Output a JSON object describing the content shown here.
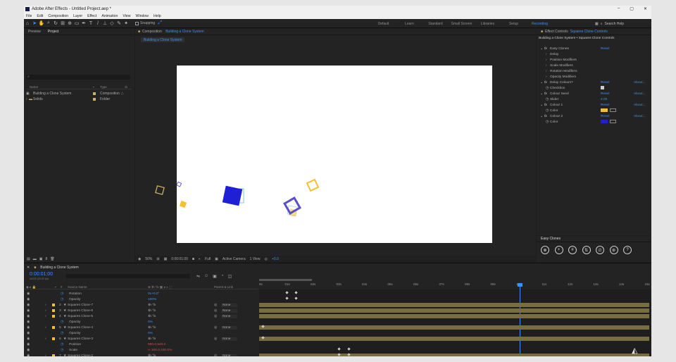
{
  "window": {
    "title": "Adobe After Effects - Untitled Project.aep *",
    "controls": [
      "–",
      "▢",
      "✕"
    ]
  },
  "menu": [
    "File",
    "Edit",
    "Composition",
    "Layer",
    "Effect",
    "Animation",
    "View",
    "Window",
    "Help"
  ],
  "toolbar": {
    "snapping": "Snapping"
  },
  "workspaces": [
    "Default",
    "Learn",
    "Standard",
    "Small Screen",
    "Libraries",
    "Setup",
    "Recording"
  ],
  "active_workspace": "Recording",
  "search_help": "Search Help",
  "project": {
    "tabs": [
      "Preview",
      "Project"
    ],
    "active_tab": "Project",
    "columns": [
      "Name",
      "Type",
      "Si"
    ],
    "items": [
      {
        "name": "Building a Clone System",
        "type": "Composition",
        "color": "#c9b26a"
      },
      {
        "name": "Solids",
        "type": "Folder",
        "color": "#c9b26a"
      }
    ]
  },
  "composition": {
    "panel_title": "Composition",
    "name": "Building a Clone System",
    "tab": "Building a Clone System",
    "zoom": "50%",
    "timecode": "0:00:01:00",
    "resolution": "Full",
    "camera": "Active Camera",
    "views": "1 View",
    "exposure": "+0.0"
  },
  "effect_controls": {
    "title": "Effect Controls",
    "layer": "Squares Clone Controls",
    "subtitle": "Building a Clone System • Squares Clone Controls",
    "reset": "Reset",
    "about": "About...",
    "rows": [
      {
        "label": "Easy Clones",
        "indent": 0,
        "fx": true,
        "reset": true
      },
      {
        "label": "Delay",
        "indent": 1
      },
      {
        "label": "Position Modifiers",
        "indent": 1
      },
      {
        "label": "Scale Modifiers",
        "indent": 1
      },
      {
        "label": "Rotation Modifiers",
        "indent": 1
      },
      {
        "label": "Opacity Modifiers",
        "indent": 1
      },
      {
        "label": "Delay Colours?",
        "indent": 0,
        "fx": true,
        "reset": true,
        "about": true
      },
      {
        "label": "Checkbox",
        "indent": 1,
        "checkbox": true
      },
      {
        "label": "Colour Seed",
        "indent": 0,
        "fx": true,
        "reset": true,
        "about": true
      },
      {
        "label": "Slider",
        "indent": 1,
        "value": "2.00"
      },
      {
        "label": "Colour 1",
        "indent": 0,
        "fx": true,
        "reset": true,
        "about": true
      },
      {
        "label": "Color",
        "indent": 1,
        "swatch": "#f2c12e"
      },
      {
        "label": "Colour 2",
        "indent": 0,
        "fx": true,
        "reset": true,
        "about": true
      },
      {
        "label": "Color",
        "indent": 1,
        "swatch": "#1f1fd6"
      }
    ]
  },
  "easy_clones": {
    "title": "Easy Clones",
    "icons": [
      "⊗",
      "+",
      "#",
      "⇅",
      "∅",
      "⊛",
      "?"
    ]
  },
  "timeline": {
    "tab": "Building a Clone System",
    "timecode": "0:00:01:00",
    "timecode_sub": "00025 (25.00 fps)",
    "columns": [
      "#",
      "Source Name",
      "Parent & Link"
    ],
    "ruler": [
      "0s",
      "01s",
      "02s",
      "03s",
      "04s",
      "05s",
      "06s",
      "07s",
      "08s",
      "09s",
      "10s",
      "11s",
      "12s",
      "13s",
      "14s",
      "15s"
    ],
    "layers": [
      {
        "num": "",
        "name": "Rotation",
        "prop": true,
        "value": "0x+0.0°"
      },
      {
        "num": "",
        "name": "Opacity",
        "prop": true,
        "value": "100%"
      },
      {
        "num": "2",
        "name": "Squares Clone-7",
        "parent": "None"
      },
      {
        "num": "3",
        "name": "Squares Clone-6",
        "parent": "None"
      },
      {
        "num": "4",
        "name": "Squares Clone-5",
        "parent": "None"
      },
      {
        "num": "",
        "name": "Opacity",
        "prop": true,
        "value": "0%"
      },
      {
        "num": "5",
        "name": "Squares Clone-4",
        "parent": "None"
      },
      {
        "num": "",
        "name": "Opacity",
        "prop": true,
        "value": "0%"
      },
      {
        "num": "6",
        "name": "Squares Clone-3",
        "parent": "None"
      },
      {
        "num": "",
        "name": "Position",
        "prop": true,
        "value": "960.0,540.0"
      },
      {
        "num": "",
        "name": "Scale",
        "prop": true,
        "value": "∞ 100.0,100.0%"
      },
      {
        "num": "7",
        "name": "Squares Clone-2",
        "parent": "None"
      }
    ]
  },
  "colors": {
    "accent": "#3d8fff",
    "track": "#786d3f",
    "yellow": "#f2c12e",
    "blue": "#1f1fd6",
    "purple": "#5a4fc9"
  }
}
